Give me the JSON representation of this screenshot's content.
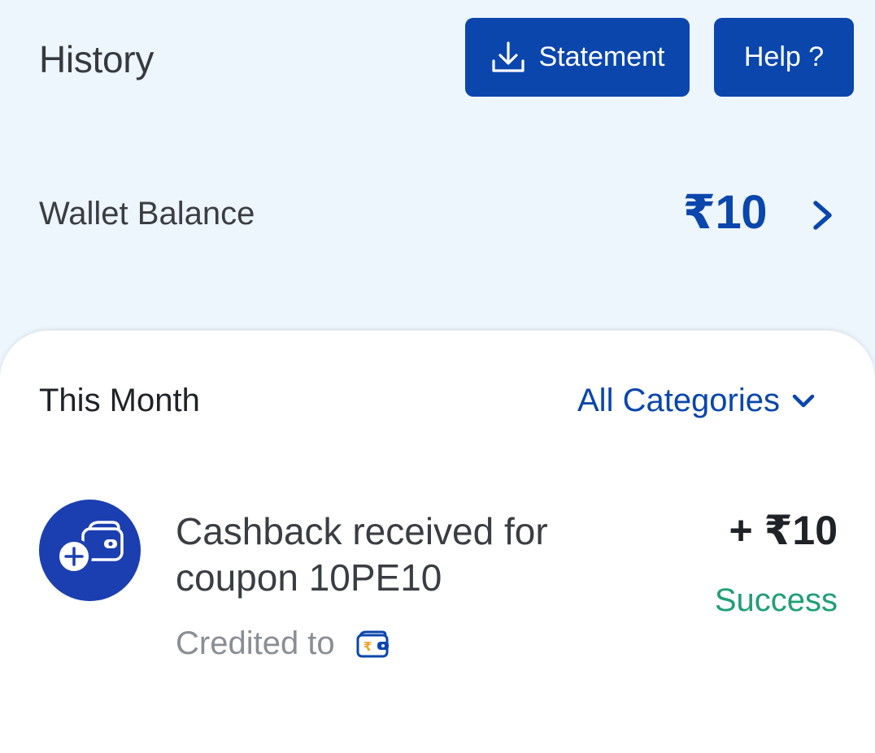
{
  "header": {
    "title": "History",
    "statement_label": "Statement",
    "help_label": "Help ?"
  },
  "wallet": {
    "label": "Wallet Balance",
    "amount": "₹10"
  },
  "filter": {
    "period": "This Month",
    "category": "All Categories"
  },
  "transactions": [
    {
      "title": "Cashback received for coupon 10PE10",
      "amount": "+ ₹10",
      "status": "Success",
      "credited_label": "Credited to",
      "icon": "wallet-add-icon"
    }
  ],
  "colors": {
    "primary": "#0b46ad",
    "background": "#edf5fd",
    "success": "#1f9f76",
    "avatar": "#1b3fb0"
  }
}
